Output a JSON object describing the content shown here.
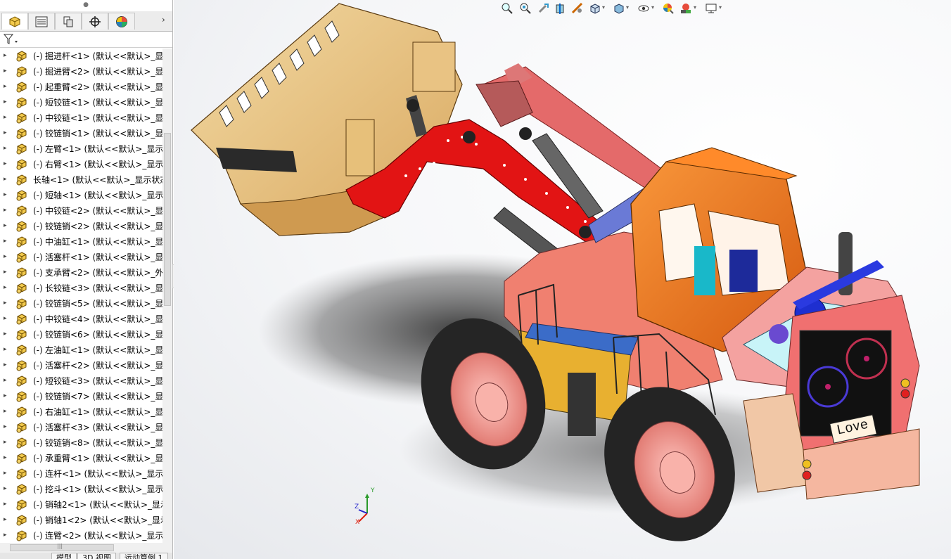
{
  "feature_tree": {
    "items": [
      {
        "prefix": "(-)",
        "text": "掘进杆<1> (默认<<默认>_显示",
        "expanded": false
      },
      {
        "prefix": "(-)",
        "text": "掘进臂<2> (默认<<默认>_显示",
        "expanded": false
      },
      {
        "prefix": "(-)",
        "text": "起重臂<2> (默认<<默认>_显示",
        "expanded": false
      },
      {
        "prefix": "(-)",
        "text": "短铰链<1> (默认<<默认>_显示",
        "expanded": false
      },
      {
        "prefix": "(-)",
        "text": "中铰链<1> (默认<<默认>_显示",
        "expanded": false
      },
      {
        "prefix": "(-)",
        "text": "铰链销<1> (默认<<默认>_显示",
        "expanded": false
      },
      {
        "prefix": "(-)",
        "text": "左臂<1> (默认<<默认>_显示状",
        "expanded": false
      },
      {
        "prefix": "(-)",
        "text": "右臂<1> (默认<<默认>_显示状",
        "expanded": false
      },
      {
        "prefix": "",
        "text": "长轴<1> (默认<<默认>_显示状态",
        "expanded": false
      },
      {
        "prefix": "(-)",
        "text": "短轴<1> (默认<<默认>_显示状",
        "expanded": false
      },
      {
        "prefix": "(-)",
        "text": "中铰链<2> (默认<<默认>_显示",
        "expanded": false
      },
      {
        "prefix": "(-)",
        "text": "铰链销<2> (默认<<默认>_显示",
        "expanded": false
      },
      {
        "prefix": "(-)",
        "text": "中油缸<1> (默认<<默认>_显示",
        "expanded": false
      },
      {
        "prefix": "(-)",
        "text": "活塞杆<1> (默认<<默认>_显示",
        "expanded": false
      },
      {
        "prefix": "(-)",
        "text": "支承臂<2> (默认<<默认>_外观",
        "expanded": false
      },
      {
        "prefix": "(-)",
        "text": "长铰链<3> (默认<<默认>_显示",
        "expanded": false
      },
      {
        "prefix": "(-)",
        "text": "铰链销<5> (默认<<默认>_显示",
        "expanded": false
      },
      {
        "prefix": "(-)",
        "text": "中铰链<4> (默认<<默认>_显示",
        "expanded": false
      },
      {
        "prefix": "(-)",
        "text": "铰链销<6> (默认<<默认>_显示",
        "expanded": false
      },
      {
        "prefix": "(-)",
        "text": "左油缸<1> (默认<<默认>_显示",
        "expanded": false
      },
      {
        "prefix": "(-)",
        "text": "活塞杆<2> (默认<<默认>_显示",
        "expanded": false
      },
      {
        "prefix": "(-)",
        "text": "短铰链<3> (默认<<默认>_显示",
        "expanded": false
      },
      {
        "prefix": "(-)",
        "text": "铰链销<7> (默认<<默认>_显示",
        "expanded": false
      },
      {
        "prefix": "(-)",
        "text": "右油缸<1> (默认<<默认>_显示",
        "expanded": false
      },
      {
        "prefix": "(-)",
        "text": "活塞杆<3> (默认<<默认>_显示",
        "expanded": false
      },
      {
        "prefix": "(-)",
        "text": "铰链销<8> (默认<<默认>_显示",
        "expanded": false
      },
      {
        "prefix": "(-)",
        "text": "承重臂<1> (默认<<默认>_显示",
        "expanded": false
      },
      {
        "prefix": "(-)",
        "text": "连杆<1> (默认<<默认>_显示状",
        "expanded": false
      },
      {
        "prefix": "(-)",
        "text": "挖斗<1> (默认<<默认>_显示状",
        "expanded": false
      },
      {
        "prefix": "(-)",
        "text": "销轴2<1> (默认<<默认>_显示",
        "expanded": false
      },
      {
        "prefix": "(-)",
        "text": "销轴1<2> (默认<<默认>_显示",
        "expanded": false
      },
      {
        "prefix": "(-)",
        "text": "连臂<2> (默认<<默认>_显示状",
        "expanded": false
      }
    ]
  },
  "left_tabs": [
    {
      "name": "feature-manager-tab",
      "icon": "part-cube-icon"
    },
    {
      "name": "property-manager-tab",
      "icon": "property-list-icon"
    },
    {
      "name": "configuration-manager-tab",
      "icon": "configuration-icon"
    },
    {
      "name": "dimxpert-tab",
      "icon": "crosshair-icon"
    },
    {
      "name": "display-manager-tab",
      "icon": "appearance-sphere-icon"
    }
  ],
  "bottom_tabs": [
    {
      "label": "模型"
    },
    {
      "label": "3D 视图"
    },
    {
      "label": "运动算例 1"
    }
  ],
  "viewport": {
    "nameplate_text": "Love",
    "triad_labels": {
      "x": "X",
      "y": "Y",
      "z": "Z"
    }
  },
  "colors": {
    "bucket": "#e8c98a",
    "arm_red": "#e01010",
    "cab_orange": "#f07820",
    "body_pink": "#f4a2a0",
    "tire": "#2a2a2a",
    "wheel_hub": "#f6a09a",
    "cyan_panel": "#c8f4f8"
  }
}
